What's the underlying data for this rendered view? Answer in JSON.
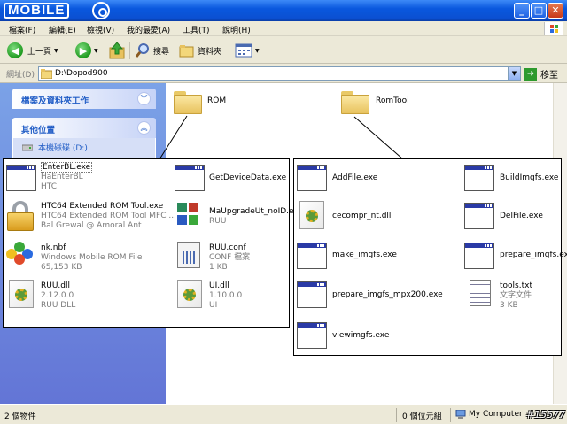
{
  "window": {
    "logo_text": "MOBILE",
    "buttons": [
      "_",
      "□",
      "✕"
    ]
  },
  "menu": [
    "檔案(F)",
    "編輯(E)",
    "檢視(V)",
    "我的最愛(A)",
    "工具(T)",
    "說明(H)"
  ],
  "toolbar": {
    "back_label": "上一頁",
    "search_label": "搜尋",
    "folders_label": "資料夾"
  },
  "address": {
    "label": "網址(D)",
    "value": "D:\\Dopod900",
    "go_label": "移至"
  },
  "taskpane": {
    "file_tasks": "檔案及資料夾工作",
    "other_places": "其他位置",
    "drive_link": "本機磁碟 (D:)"
  },
  "folders": [
    {
      "name": "ROM"
    },
    {
      "name": "RomTool"
    }
  ],
  "rom_files": [
    {
      "name": "EnterBL.exe",
      "meta": [
        "HaEnterBL",
        "HTC"
      ],
      "icon": "exe"
    },
    {
      "name": "GetDeviceData.exe",
      "meta": [],
      "icon": "exe"
    },
    {
      "name": "HTC64 Extended ROM Tool.exe",
      "meta": [
        "HTC64 Extended ROM Tool MFC ...",
        "Bal Grewal @ Amoral Ant"
      ],
      "icon": "lock"
    },
    {
      "name": "MaUpgradeUt_noID.exe",
      "meta": [
        "RUU"
      ],
      "icon": "upgrade"
    },
    {
      "name": "nk.nbf",
      "meta": [
        "Windows Mobile ROM File",
        "65,153 KB"
      ],
      "icon": "nbf"
    },
    {
      "name": "RUU.conf",
      "meta": [
        "CONF 檔案",
        "1 KB"
      ],
      "icon": "conf"
    },
    {
      "name": "RUU.dll",
      "meta": [
        "2.12.0.0",
        "RUU DLL"
      ],
      "icon": "dll"
    },
    {
      "name": "UI.dll",
      "meta": [
        "1.10.0.0",
        "UI"
      ],
      "icon": "dll"
    }
  ],
  "romtool_files": [
    {
      "name": "AddFile.exe",
      "meta": [],
      "icon": "exe"
    },
    {
      "name": "BuildImgfs.exe",
      "meta": [],
      "icon": "exe"
    },
    {
      "name": "cecompr_nt.dll",
      "meta": [],
      "icon": "dll"
    },
    {
      "name": "DelFile.exe",
      "meta": [],
      "icon": "exe"
    },
    {
      "name": "make_imgfs.exe",
      "meta": [],
      "icon": "exe"
    },
    {
      "name": "prepare_imgfs.exe",
      "meta": [],
      "icon": "exe"
    },
    {
      "name": "prepare_imgfs_mpx200.exe",
      "meta": [],
      "icon": "exe"
    },
    {
      "name": "tools.txt",
      "meta": [
        "文字文件",
        "3 KB"
      ],
      "icon": "txt"
    },
    {
      "name": "viewimgfs.exe",
      "meta": [],
      "icon": "exe"
    }
  ],
  "status": {
    "objects": "2 個物件",
    "size": "0 個位元組",
    "location": "My Computer",
    "watermark": "#15577"
  }
}
